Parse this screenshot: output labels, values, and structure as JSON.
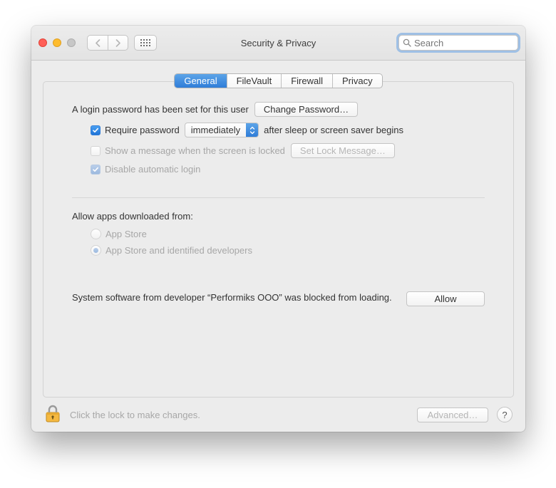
{
  "window_title": "Security & Privacy",
  "search": {
    "placeholder": "Search"
  },
  "tabs": [
    "General",
    "FileVault",
    "Firewall",
    "Privacy"
  ],
  "active_tab": 0,
  "login_password_text": "A login password has been set for this user",
  "change_password_btn": "Change Password…",
  "require_password_label": "Require password",
  "require_password_delay": "immediately",
  "require_password_suffix": "after sleep or screen saver begins",
  "show_message_label": "Show a message when the screen is locked",
  "set_lock_message_btn": "Set Lock Message…",
  "disable_auto_login_label": "Disable automatic login",
  "allow_apps_title": "Allow apps downloaded from:",
  "radio_app_store": "App Store",
  "radio_app_store_dev": "App Store and identified developers",
  "blocked_text": "System software from developer “Performiks OOO” was blocked from loading.",
  "allow_btn": "Allow",
  "lock_hint": "Click the lock to make changes.",
  "advanced_btn": "Advanced…",
  "help": "?"
}
